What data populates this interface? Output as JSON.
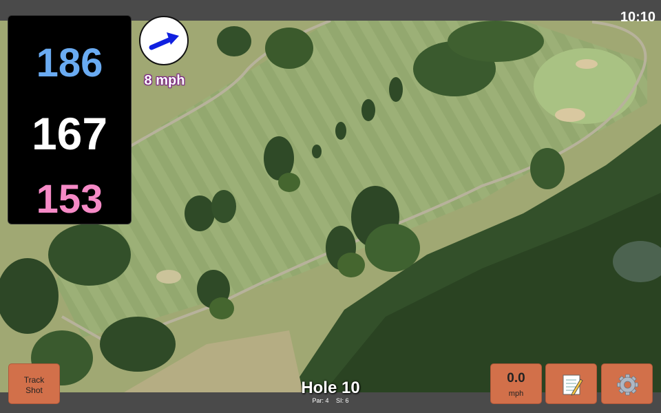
{
  "status": {
    "time": "10:10"
  },
  "distances": {
    "back": "186",
    "middle": "167",
    "front": "153"
  },
  "wind": {
    "speed_label": "8 mph",
    "icon": "wind-arrow-icon"
  },
  "buttons": {
    "track_shot": "Track Shot",
    "speed_value": "0.0",
    "speed_unit": "mph",
    "notes_icon": "notepad-icon",
    "settings_icon": "gear-icon"
  },
  "hole": {
    "title": "Hole 10",
    "par": "Par: 4",
    "si": "SI: 6"
  },
  "colors": {
    "button": "#d2704a",
    "back_distance": "#6aabf2",
    "front_distance": "#f58ac6",
    "bar": "#4a4a4a"
  }
}
